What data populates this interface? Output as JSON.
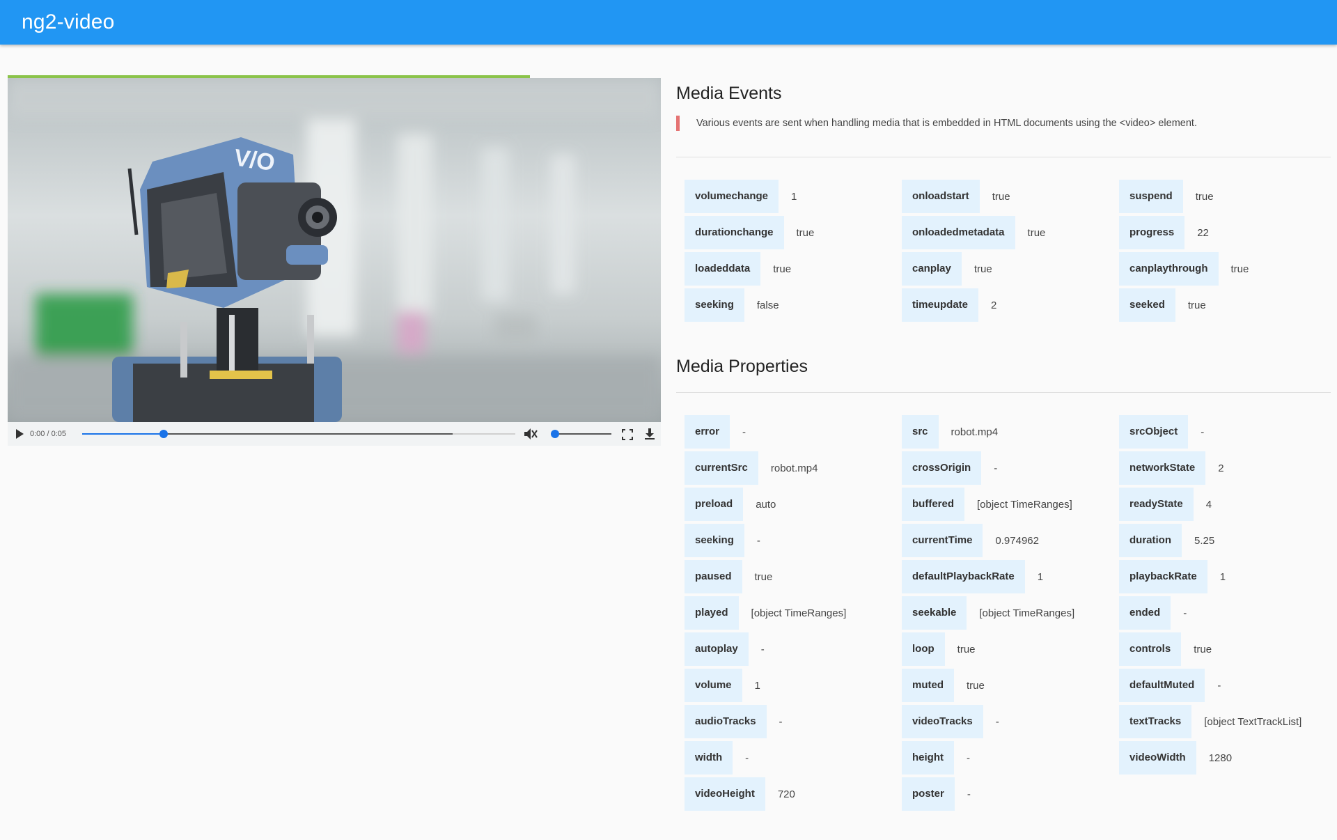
{
  "app": {
    "title": "ng2-video"
  },
  "player": {
    "time_text": "0:00 / 0:05",
    "buffer_progress": 0.855,
    "seek_played": 0.188,
    "seek_buffered": 0.855,
    "volume_level": 0.0,
    "colors": {
      "accent": "#1a73e8",
      "buffer_bar": "#8bc34a"
    }
  },
  "events": {
    "title": "Media Events",
    "description": "Various events are sent when handling media that is embedded in HTML documents using the <video> element.",
    "columns": [
      [
        {
          "key": "volumechange",
          "value": "1"
        },
        {
          "key": "durationchange",
          "value": "true"
        },
        {
          "key": "loadeddata",
          "value": "true"
        },
        {
          "key": "seeking",
          "value": "false"
        }
      ],
      [
        {
          "key": "onloadstart",
          "value": "true"
        },
        {
          "key": "onloadedmetadata",
          "value": "true"
        },
        {
          "key": "canplay",
          "value": "true"
        },
        {
          "key": "timeupdate",
          "value": "2"
        }
      ],
      [
        {
          "key": "suspend",
          "value": "true"
        },
        {
          "key": "progress",
          "value": "22"
        },
        {
          "key": "canplaythrough",
          "value": "true"
        },
        {
          "key": "seeked",
          "value": "true"
        }
      ]
    ]
  },
  "properties": {
    "title": "Media Properties",
    "columns": [
      [
        {
          "key": "error",
          "value": "-"
        },
        {
          "key": "currentSrc",
          "value": "robot.mp4"
        },
        {
          "key": "preload",
          "value": "auto"
        },
        {
          "key": "seeking",
          "value": "-"
        },
        {
          "key": "paused",
          "value": "true"
        },
        {
          "key": "played",
          "value": "[object TimeRanges]"
        },
        {
          "key": "autoplay",
          "value": "-"
        },
        {
          "key": "volume",
          "value": "1"
        },
        {
          "key": "audioTracks",
          "value": "-"
        },
        {
          "key": "width",
          "value": "-"
        },
        {
          "key": "videoHeight",
          "value": "720"
        }
      ],
      [
        {
          "key": "src",
          "value": "robot.mp4"
        },
        {
          "key": "crossOrigin",
          "value": "-"
        },
        {
          "key": "buffered",
          "value": "[object TimeRanges]"
        },
        {
          "key": "currentTime",
          "value": "0.974962"
        },
        {
          "key": "defaultPlaybackRate",
          "value": "1"
        },
        {
          "key": "seekable",
          "value": "[object TimeRanges]"
        },
        {
          "key": "loop",
          "value": "true"
        },
        {
          "key": "muted",
          "value": "true"
        },
        {
          "key": "videoTracks",
          "value": "-"
        },
        {
          "key": "height",
          "value": "-"
        },
        {
          "key": "poster",
          "value": "-"
        }
      ],
      [
        {
          "key": "srcObject",
          "value": "-"
        },
        {
          "key": "networkState",
          "value": "2"
        },
        {
          "key": "readyState",
          "value": "4"
        },
        {
          "key": "duration",
          "value": "5.25"
        },
        {
          "key": "playbackRate",
          "value": "1"
        },
        {
          "key": "ended",
          "value": "-"
        },
        {
          "key": "controls",
          "value": "true"
        },
        {
          "key": "defaultMuted",
          "value": "-"
        },
        {
          "key": "textTracks",
          "value": "[object TextTrackList]"
        },
        {
          "key": "videoWidth",
          "value": "1280"
        }
      ]
    ]
  }
}
